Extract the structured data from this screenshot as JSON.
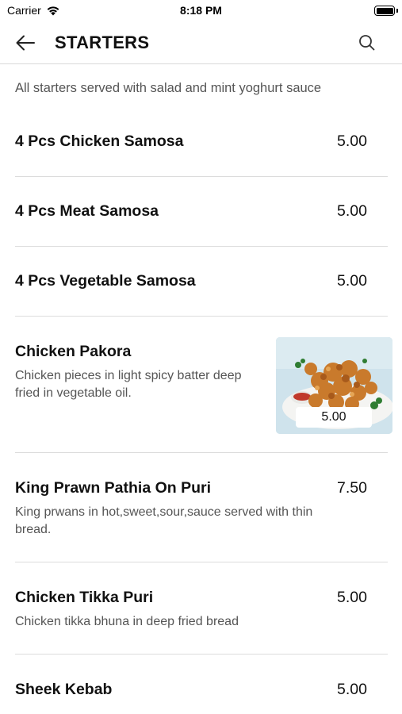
{
  "status_bar": {
    "carrier": "Carrier",
    "time": "8:18 PM"
  },
  "header": {
    "title": "STARTERS",
    "back_icon": "arrow-left-icon",
    "search_icon": "search-icon"
  },
  "intro": "All starters served with salad and mint yoghurt sauce",
  "items": [
    {
      "name": "4 Pcs Chicken Samosa",
      "price": "5.00",
      "description": ""
    },
    {
      "name": "4 Pcs Meat Samosa",
      "price": "5.00",
      "description": ""
    },
    {
      "name": "4 Pcs Vegetable Samosa",
      "price": "5.00",
      "description": ""
    },
    {
      "name": "Chicken Pakora",
      "price": "5.00",
      "description": "Chicken pieces in light spicy batter deep fried in vegetable oil."
    },
    {
      "name": "King Prawn Pathia On Puri",
      "price": "7.50",
      "description": "King prwans in hot,sweet,sour,sauce served with thin bread."
    },
    {
      "name": "Chicken Tikka Puri",
      "price": "5.00",
      "description": "Chicken tikka bhuna in deep fried bread"
    },
    {
      "name": "Sheek Kebab",
      "price": "5.00",
      "description": ""
    }
  ]
}
